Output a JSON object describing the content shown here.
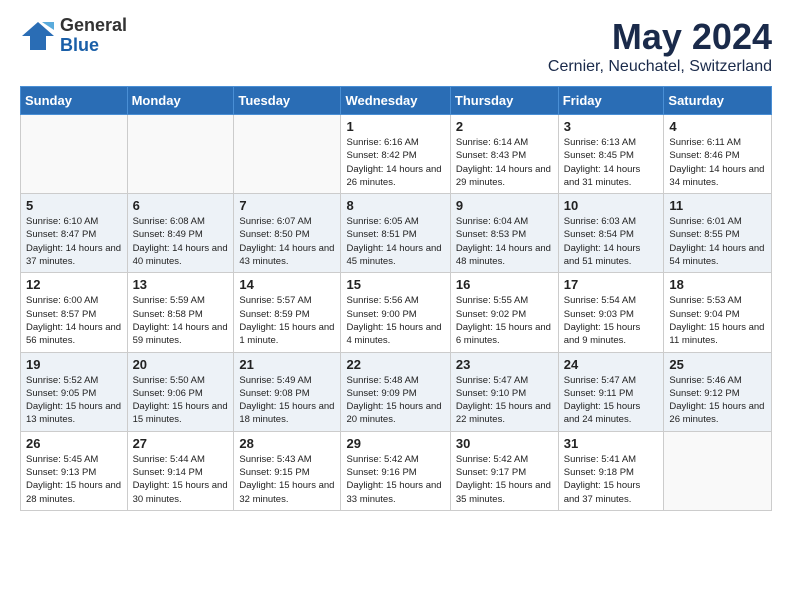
{
  "logo": {
    "general": "General",
    "blue": "Blue"
  },
  "title": "May 2024",
  "location": "Cernier, Neuchatel, Switzerland",
  "days_of_week": [
    "Sunday",
    "Monday",
    "Tuesday",
    "Wednesday",
    "Thursday",
    "Friday",
    "Saturday"
  ],
  "weeks": [
    [
      {
        "day": "",
        "empty": true
      },
      {
        "day": "",
        "empty": true
      },
      {
        "day": "",
        "empty": true
      },
      {
        "day": "1",
        "sunrise": "6:16 AM",
        "sunset": "8:42 PM",
        "daylight": "14 hours and 26 minutes."
      },
      {
        "day": "2",
        "sunrise": "6:14 AM",
        "sunset": "8:43 PM",
        "daylight": "14 hours and 29 minutes."
      },
      {
        "day": "3",
        "sunrise": "6:13 AM",
        "sunset": "8:45 PM",
        "daylight": "14 hours and 31 minutes."
      },
      {
        "day": "4",
        "sunrise": "6:11 AM",
        "sunset": "8:46 PM",
        "daylight": "14 hours and 34 minutes."
      }
    ],
    [
      {
        "day": "5",
        "sunrise": "6:10 AM",
        "sunset": "8:47 PM",
        "daylight": "14 hours and 37 minutes."
      },
      {
        "day": "6",
        "sunrise": "6:08 AM",
        "sunset": "8:49 PM",
        "daylight": "14 hours and 40 minutes."
      },
      {
        "day": "7",
        "sunrise": "6:07 AM",
        "sunset": "8:50 PM",
        "daylight": "14 hours and 43 minutes."
      },
      {
        "day": "8",
        "sunrise": "6:05 AM",
        "sunset": "8:51 PM",
        "daylight": "14 hours and 45 minutes."
      },
      {
        "day": "9",
        "sunrise": "6:04 AM",
        "sunset": "8:53 PM",
        "daylight": "14 hours and 48 minutes."
      },
      {
        "day": "10",
        "sunrise": "6:03 AM",
        "sunset": "8:54 PM",
        "daylight": "14 hours and 51 minutes."
      },
      {
        "day": "11",
        "sunrise": "6:01 AM",
        "sunset": "8:55 PM",
        "daylight": "14 hours and 54 minutes."
      }
    ],
    [
      {
        "day": "12",
        "sunrise": "6:00 AM",
        "sunset": "8:57 PM",
        "daylight": "14 hours and 56 minutes."
      },
      {
        "day": "13",
        "sunrise": "5:59 AM",
        "sunset": "8:58 PM",
        "daylight": "14 hours and 59 minutes."
      },
      {
        "day": "14",
        "sunrise": "5:57 AM",
        "sunset": "8:59 PM",
        "daylight": "15 hours and 1 minute."
      },
      {
        "day": "15",
        "sunrise": "5:56 AM",
        "sunset": "9:00 PM",
        "daylight": "15 hours and 4 minutes."
      },
      {
        "day": "16",
        "sunrise": "5:55 AM",
        "sunset": "9:02 PM",
        "daylight": "15 hours and 6 minutes."
      },
      {
        "day": "17",
        "sunrise": "5:54 AM",
        "sunset": "9:03 PM",
        "daylight": "15 hours and 9 minutes."
      },
      {
        "day": "18",
        "sunrise": "5:53 AM",
        "sunset": "9:04 PM",
        "daylight": "15 hours and 11 minutes."
      }
    ],
    [
      {
        "day": "19",
        "sunrise": "5:52 AM",
        "sunset": "9:05 PM",
        "daylight": "15 hours and 13 minutes."
      },
      {
        "day": "20",
        "sunrise": "5:50 AM",
        "sunset": "9:06 PM",
        "daylight": "15 hours and 15 minutes."
      },
      {
        "day": "21",
        "sunrise": "5:49 AM",
        "sunset": "9:08 PM",
        "daylight": "15 hours and 18 minutes."
      },
      {
        "day": "22",
        "sunrise": "5:48 AM",
        "sunset": "9:09 PM",
        "daylight": "15 hours and 20 minutes."
      },
      {
        "day": "23",
        "sunrise": "5:47 AM",
        "sunset": "9:10 PM",
        "daylight": "15 hours and 22 minutes."
      },
      {
        "day": "24",
        "sunrise": "5:47 AM",
        "sunset": "9:11 PM",
        "daylight": "15 hours and 24 minutes."
      },
      {
        "day": "25",
        "sunrise": "5:46 AM",
        "sunset": "9:12 PM",
        "daylight": "15 hours and 26 minutes."
      }
    ],
    [
      {
        "day": "26",
        "sunrise": "5:45 AM",
        "sunset": "9:13 PM",
        "daylight": "15 hours and 28 minutes."
      },
      {
        "day": "27",
        "sunrise": "5:44 AM",
        "sunset": "9:14 PM",
        "daylight": "15 hours and 30 minutes."
      },
      {
        "day": "28",
        "sunrise": "5:43 AM",
        "sunset": "9:15 PM",
        "daylight": "15 hours and 32 minutes."
      },
      {
        "day": "29",
        "sunrise": "5:42 AM",
        "sunset": "9:16 PM",
        "daylight": "15 hours and 33 minutes."
      },
      {
        "day": "30",
        "sunrise": "5:42 AM",
        "sunset": "9:17 PM",
        "daylight": "15 hours and 35 minutes."
      },
      {
        "day": "31",
        "sunrise": "5:41 AM",
        "sunset": "9:18 PM",
        "daylight": "15 hours and 37 minutes."
      },
      {
        "day": "",
        "empty": true
      }
    ]
  ]
}
